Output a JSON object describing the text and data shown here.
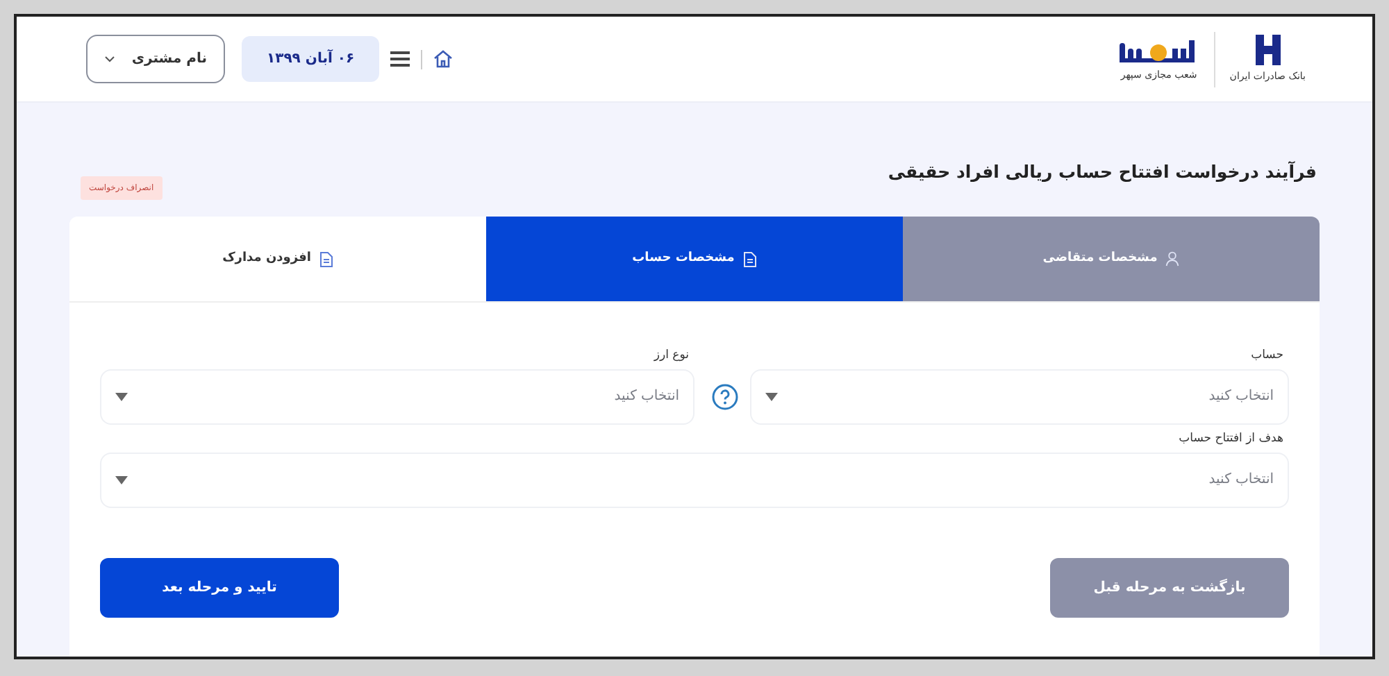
{
  "header": {
    "bank_name": "بانک صادرات ایران",
    "branch_name": "شعب مجازی سپهر",
    "date": "۰۶ آبان ۱۳۹۹",
    "customer": {
      "label": "نام مشتری"
    }
  },
  "page": {
    "title": "فرآیند درخواست افتتاح حساب ریالی افراد حقیقی",
    "cancel_label": "انصراف درخواست"
  },
  "steps": [
    {
      "label": "مشخصات متقاضی",
      "selected": false,
      "completed": true
    },
    {
      "label": "مشخصات حساب",
      "selected": true,
      "completed": false
    },
    {
      "label": "افزودن مدارک",
      "selected": false,
      "completed": false
    }
  ],
  "fields": [
    {
      "label": "حساب",
      "placeholder": "انتخاب کنید",
      "help": true,
      "wide": false
    },
    {
      "label": "نوع ارز",
      "placeholder": "انتخاب کنید",
      "help": false,
      "wide": false
    },
    {
      "label": "هدف از افتتاح حساب",
      "placeholder": "انتخاب کنید",
      "help": false,
      "wide": true
    }
  ],
  "buttons": [
    {
      "label": "بازگشت به مرحله قبل",
      "kind": "secondary"
    },
    {
      "label": "تایید و مرحله بعد",
      "kind": "primary"
    }
  ]
}
